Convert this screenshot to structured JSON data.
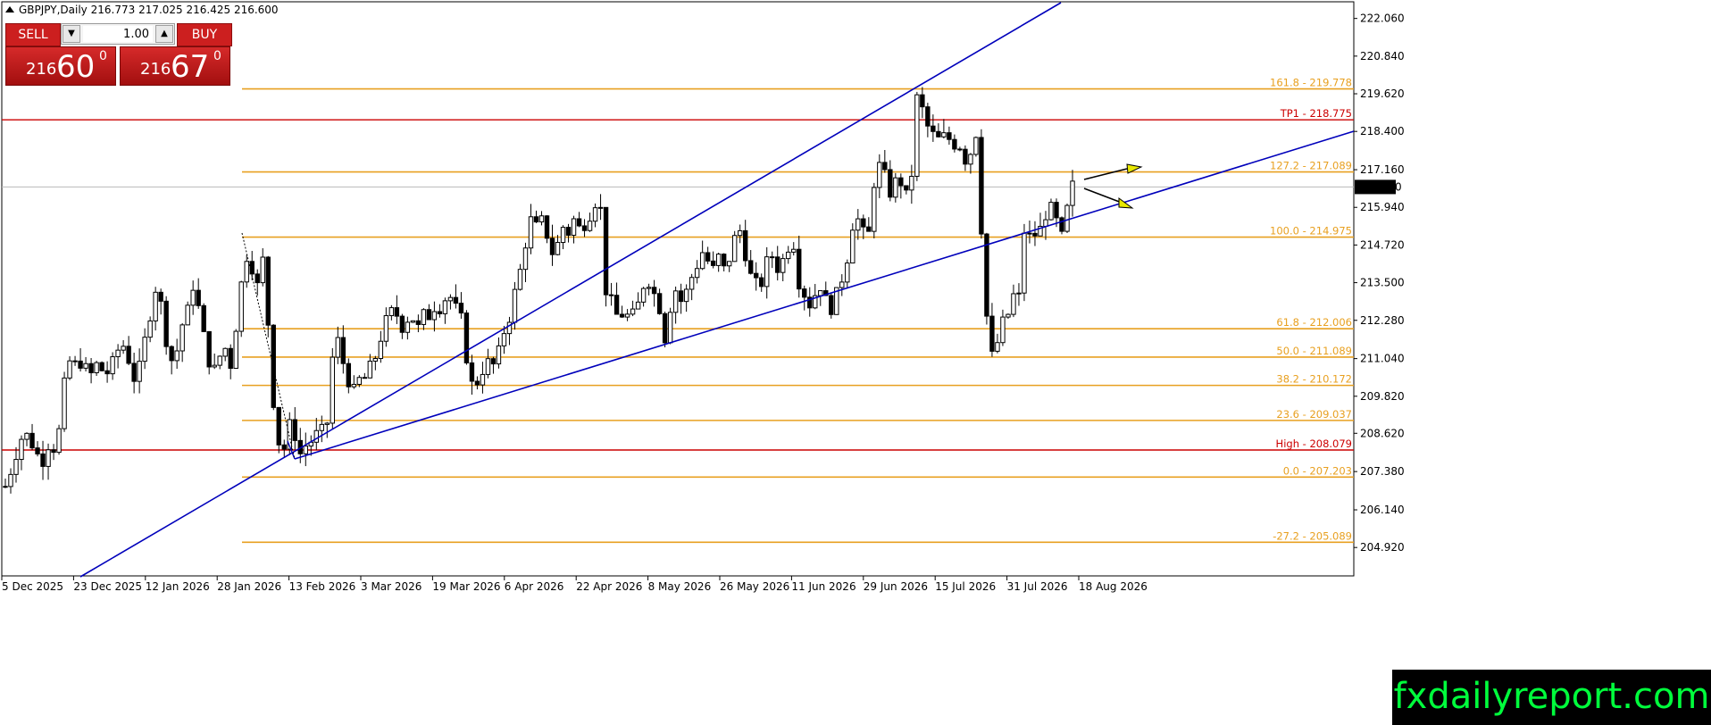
{
  "title": {
    "symbol_timeframe": "GBPJPY,Daily",
    "ohlc": "216.773 217.025 216.425 216.600"
  },
  "trade_panel": {
    "sell_label": "SELL",
    "buy_label": "BUY",
    "lot_value": "1.00",
    "sell_price": {
      "small": "216",
      "big": "60",
      "sup": "0"
    },
    "buy_price": {
      "small": "216",
      "big": "67",
      "sup": "0"
    },
    "accent_color": "#cc1f1f"
  },
  "brand_text": "fxdailyreport.com",
  "icons": {
    "lot_down": "triangle-down-icon",
    "lot_up": "triangle-up-icon",
    "title": "triangle-up-icon"
  },
  "chart_data": {
    "type": "candlestick",
    "y_axis_ticks": [
      "222.060",
      "220.840",
      "219.620",
      "218.400",
      "217.160",
      "215.940",
      "214.720",
      "213.500",
      "212.280",
      "211.040",
      "209.820",
      "208.620",
      "207.380",
      "206.140",
      "204.920"
    ],
    "ylim": [
      204.0,
      222.6
    ],
    "x_axis_ticks": [
      "5 Dec 2025",
      "23 Dec 2025",
      "12 Jan 2026",
      "28 Jan 2026",
      "13 Feb 2026",
      "3 Mar 2026",
      "19 Mar 2026",
      "6 Apr 2026",
      "22 Apr 2026",
      "8 May 2026",
      "26 May 2026",
      "11 Jun 2026",
      "29 Jun 2026",
      "15 Jul 2026",
      "31 Jul 2026",
      "18 Aug 2026"
    ],
    "current_price": "216.600",
    "horizontal_lines": [
      {
        "label": "TP1 - 218.775",
        "price": 218.775,
        "color": "#cc0000"
      },
      {
        "label": "High - 208.079",
        "price": 208.079,
        "color": "#cc0000"
      }
    ],
    "fib_levels": [
      {
        "label": "161.8 - 219.778",
        "price": 219.778
      },
      {
        "label": "127.2 - 217.089",
        "price": 217.089
      },
      {
        "label": "100.0 - 214.975",
        "price": 214.975
      },
      {
        "label": "61.8 - 212.006",
        "price": 212.006
      },
      {
        "label": "50.0 - 211.089",
        "price": 211.089
      },
      {
        "label": "38.2 - 210.172",
        "price": 210.172
      },
      {
        "label": "23.6 - 209.037",
        "price": 209.037
      },
      {
        "label": "0.0 - 207.203",
        "price": 207.203
      },
      {
        "label": "-27.2 - 205.089",
        "price": 205.089
      }
    ],
    "fib_color": "#e8a020",
    "trendline_color": "#0000bb",
    "arrow_color": "#e8e800",
    "price_path": [
      [
        0,
        206.9
      ],
      [
        8,
        207.6
      ],
      [
        14,
        208.2
      ],
      [
        20,
        208.6
      ],
      [
        26,
        208.5
      ],
      [
        34,
        208.1
      ],
      [
        40,
        207.6
      ],
      [
        48,
        208.3
      ],
      [
        58,
        208.1
      ],
      [
        64,
        209.6
      ],
      [
        70,
        211.0
      ],
      [
        78,
        210.8
      ],
      [
        86,
        211.0
      ],
      [
        94,
        210.4
      ],
      [
        104,
        210.9
      ],
      [
        112,
        210.5
      ],
      [
        120,
        210.8
      ],
      [
        126,
        211.3
      ],
      [
        134,
        211.5
      ],
      [
        140,
        210.9
      ],
      [
        146,
        210.3
      ],
      [
        152,
        210.8
      ],
      [
        158,
        211.8
      ],
      [
        164,
        212.7
      ],
      [
        170,
        213.5
      ],
      [
        176,
        212.6
      ],
      [
        182,
        211.5
      ],
      [
        188,
        210.9
      ],
      [
        194,
        211.4
      ],
      [
        200,
        212.3
      ],
      [
        206,
        212.6
      ],
      [
        212,
        213.6
      ],
      [
        218,
        212.5
      ],
      [
        224,
        211.6
      ],
      [
        230,
        210.9
      ],
      [
        236,
        210.6
      ],
      [
        242,
        211.2
      ],
      [
        248,
        211.4
      ],
      [
        254,
        210.8
      ],
      [
        260,
        212.3
      ],
      [
        266,
        213.6
      ],
      [
        272,
        214.5
      ],
      [
        278,
        214.0
      ],
      [
        284,
        213.3
      ],
      [
        290,
        214.3
      ],
      [
        296,
        212.0
      ],
      [
        300,
        210.1
      ],
      [
        304,
        209.0
      ],
      [
        310,
        207.9
      ],
      [
        316,
        208.3
      ],
      [
        322,
        209.2
      ],
      [
        328,
        208.2
      ],
      [
        334,
        207.8
      ],
      [
        340,
        208.5
      ],
      [
        346,
        208.3
      ],
      [
        352,
        208.7
      ],
      [
        358,
        208.6
      ],
      [
        364,
        209.2
      ],
      [
        370,
        212.1
      ],
      [
        376,
        211.3
      ],
      [
        382,
        210.7
      ],
      [
        388,
        210.2
      ],
      [
        394,
        209.8
      ],
      [
        400,
        210.6
      ],
      [
        406,
        210.3
      ],
      [
        412,
        210.9
      ],
      [
        418,
        211.2
      ],
      [
        424,
        212.0
      ],
      [
        430,
        212.3
      ],
      [
        436,
        212.6
      ],
      [
        442,
        212.4
      ],
      [
        448,
        212.0
      ],
      [
        454,
        212.5
      ],
      [
        460,
        212.3
      ],
      [
        466,
        211.9
      ],
      [
        472,
        212.6
      ],
      [
        478,
        212.4
      ],
      [
        484,
        212.9
      ],
      [
        490,
        212.7
      ],
      [
        496,
        213.1
      ],
      [
        502,
        213.0
      ],
      [
        508,
        212.5
      ],
      [
        514,
        212.2
      ],
      [
        520,
        210.8
      ],
      [
        526,
        210.0
      ],
      [
        532,
        210.4
      ],
      [
        538,
        210.8
      ],
      [
        544,
        210.9
      ],
      [
        550,
        210.8
      ],
      [
        556,
        211.3
      ],
      [
        562,
        212.1
      ],
      [
        568,
        212.5
      ],
      [
        574,
        213.3
      ],
      [
        580,
        214.0
      ],
      [
        586,
        215.0
      ],
      [
        592,
        215.6
      ],
      [
        598,
        215.2
      ],
      [
        604,
        215.5
      ],
      [
        610,
        215.0
      ],
      [
        616,
        214.4
      ],
      [
        622,
        214.8
      ],
      [
        628,
        215.4
      ],
      [
        634,
        215.1
      ],
      [
        640,
        215.6
      ],
      [
        646,
        215.2
      ],
      [
        652,
        215.5
      ],
      [
        658,
        215.8
      ],
      [
        664,
        216.2
      ],
      [
        670,
        215.8
      ],
      [
        676,
        213.0
      ],
      [
        682,
        212.8
      ],
      [
        688,
        212.4
      ],
      [
        694,
        212.5
      ],
      [
        700,
        212.4
      ],
      [
        706,
        212.4
      ],
      [
        712,
        212.8
      ],
      [
        718,
        213.5
      ],
      [
        724,
        213.6
      ],
      [
        730,
        213.1
      ],
      [
        736,
        212.7
      ],
      [
        742,
        211.7
      ],
      [
        748,
        212.8
      ],
      [
        754,
        213.3
      ],
      [
        760,
        212.9
      ],
      [
        766,
        213.2
      ],
      [
        772,
        213.7
      ],
      [
        778,
        214.1
      ],
      [
        784,
        214.5
      ],
      [
        790,
        214.2
      ],
      [
        796,
        213.9
      ],
      [
        802,
        214.3
      ],
      [
        808,
        213.9
      ],
      [
        814,
        214.3
      ],
      [
        820,
        214.9
      ],
      [
        826,
        215.2
      ],
      [
        832,
        214.5
      ],
      [
        838,
        213.7
      ],
      [
        844,
        213.4
      ],
      [
        850,
        213.5
      ],
      [
        856,
        214.1
      ],
      [
        862,
        214.4
      ],
      [
        868,
        214.0
      ],
      [
        874,
        214.2
      ],
      [
        880,
        214.7
      ],
      [
        886,
        214.9
      ],
      [
        892,
        213.6
      ],
      [
        898,
        213.2
      ],
      [
        904,
        212.8
      ],
      [
        910,
        213.1
      ],
      [
        916,
        213.5
      ],
      [
        922,
        212.9
      ],
      [
        928,
        212.7
      ],
      [
        934,
        213.0
      ],
      [
        940,
        213.6
      ],
      [
        946,
        214.2
      ],
      [
        952,
        215.4
      ],
      [
        958,
        215.6
      ],
      [
        964,
        215.1
      ],
      [
        970,
        214.8
      ],
      [
        976,
        216.7
      ],
      [
        982,
        217.3
      ],
      [
        988,
        217.0
      ],
      [
        994,
        216.4
      ],
      [
        1000,
        216.7
      ],
      [
        1006,
        216.9
      ],
      [
        1012,
        216.2
      ],
      [
        1018,
        216.5
      ],
      [
        1024,
        219.5
      ],
      [
        1030,
        219.2
      ],
      [
        1036,
        218.6
      ],
      [
        1042,
        218.3
      ],
      [
        1048,
        218.1
      ],
      [
        1054,
        218.2
      ],
      [
        1060,
        218.2
      ],
      [
        1066,
        218.0
      ],
      [
        1072,
        218.1
      ],
      [
        1078,
        217.5
      ],
      [
        1084,
        217.6
      ],
      [
        1090,
        218.2
      ],
      [
        1094,
        218.7
      ],
      [
        1098,
        214.8
      ],
      [
        1104,
        212.2
      ],
      [
        1110,
        211.0
      ],
      [
        1116,
        211.6
      ],
      [
        1122,
        212.2
      ],
      [
        1128,
        212.5
      ],
      [
        1134,
        213.1
      ],
      [
        1140,
        213.0
      ],
      [
        1144,
        215.3
      ],
      [
        1150,
        214.9
      ],
      [
        1156,
        215.1
      ],
      [
        1162,
        215.0
      ],
      [
        1168,
        215.7
      ],
      [
        1174,
        215.9
      ],
      [
        1180,
        215.7
      ],
      [
        1186,
        214.9
      ],
      [
        1192,
        215.0
      ],
      [
        1196,
        216.7
      ],
      [
        1200,
        216.6
      ]
    ]
  }
}
